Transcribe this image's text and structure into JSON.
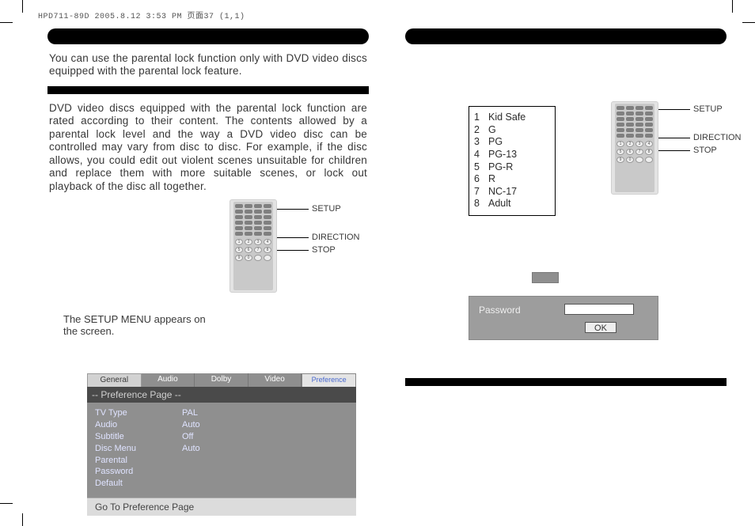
{
  "slug": "HPD711-89D  2005.8.12  3:53 PM  页面37 (1,1)",
  "left": {
    "intro": "You can use the parental lock function only with DVD video discs equipped with the parental lock feature.",
    "ratingPara": "DVD video discs equipped with the parental lock function are rated according to their content. The contents allowed by a parental lock level and the way a DVD video disc can be controlled may vary from disc to disc.  For example, if the disc allows, you could edit out violent scenes unsuitable for children and replace them with more suitable scenes, or lock out playback of the disc all together.",
    "remoteLabels": {
      "setup": "SETUP",
      "direction": "DIRECTION",
      "stop": "STOP"
    },
    "caption": "The SETUP MENU appears on the screen.",
    "tabs": {
      "general": "General",
      "audio": "Audio",
      "dolby": "Dolby",
      "video": "Video",
      "preference": "Preference"
    },
    "menuTitle": "-- Preference Page --",
    "rows": [
      {
        "k": "TV Type",
        "v": "PAL"
      },
      {
        "k": "Audio",
        "v": "Auto"
      },
      {
        "k": "Subtitle",
        "v": "Off"
      },
      {
        "k": "Disc Menu",
        "v": "Auto"
      },
      {
        "k": "Parental",
        "v": ""
      },
      {
        "k": "Password",
        "v": ""
      },
      {
        "k": "Default",
        "v": ""
      }
    ],
    "menuFoot": "Go To Preference Page"
  },
  "right": {
    "ratings": [
      {
        "n": "1",
        "t": "Kid Safe"
      },
      {
        "n": "2",
        "t": "G"
      },
      {
        "n": "3",
        "t": "PG"
      },
      {
        "n": "4",
        "t": "PG-13"
      },
      {
        "n": "5",
        "t": "PG-R"
      },
      {
        "n": "6",
        "t": "R"
      },
      {
        "n": "7",
        "t": "NC-17"
      },
      {
        "n": "8",
        "t": "Adult"
      }
    ],
    "remoteLabels": {
      "setup": "SETUP",
      "direction": "DIRECTION",
      "stop": "STOP"
    },
    "password": {
      "label": "Password",
      "ok": "OK"
    }
  }
}
